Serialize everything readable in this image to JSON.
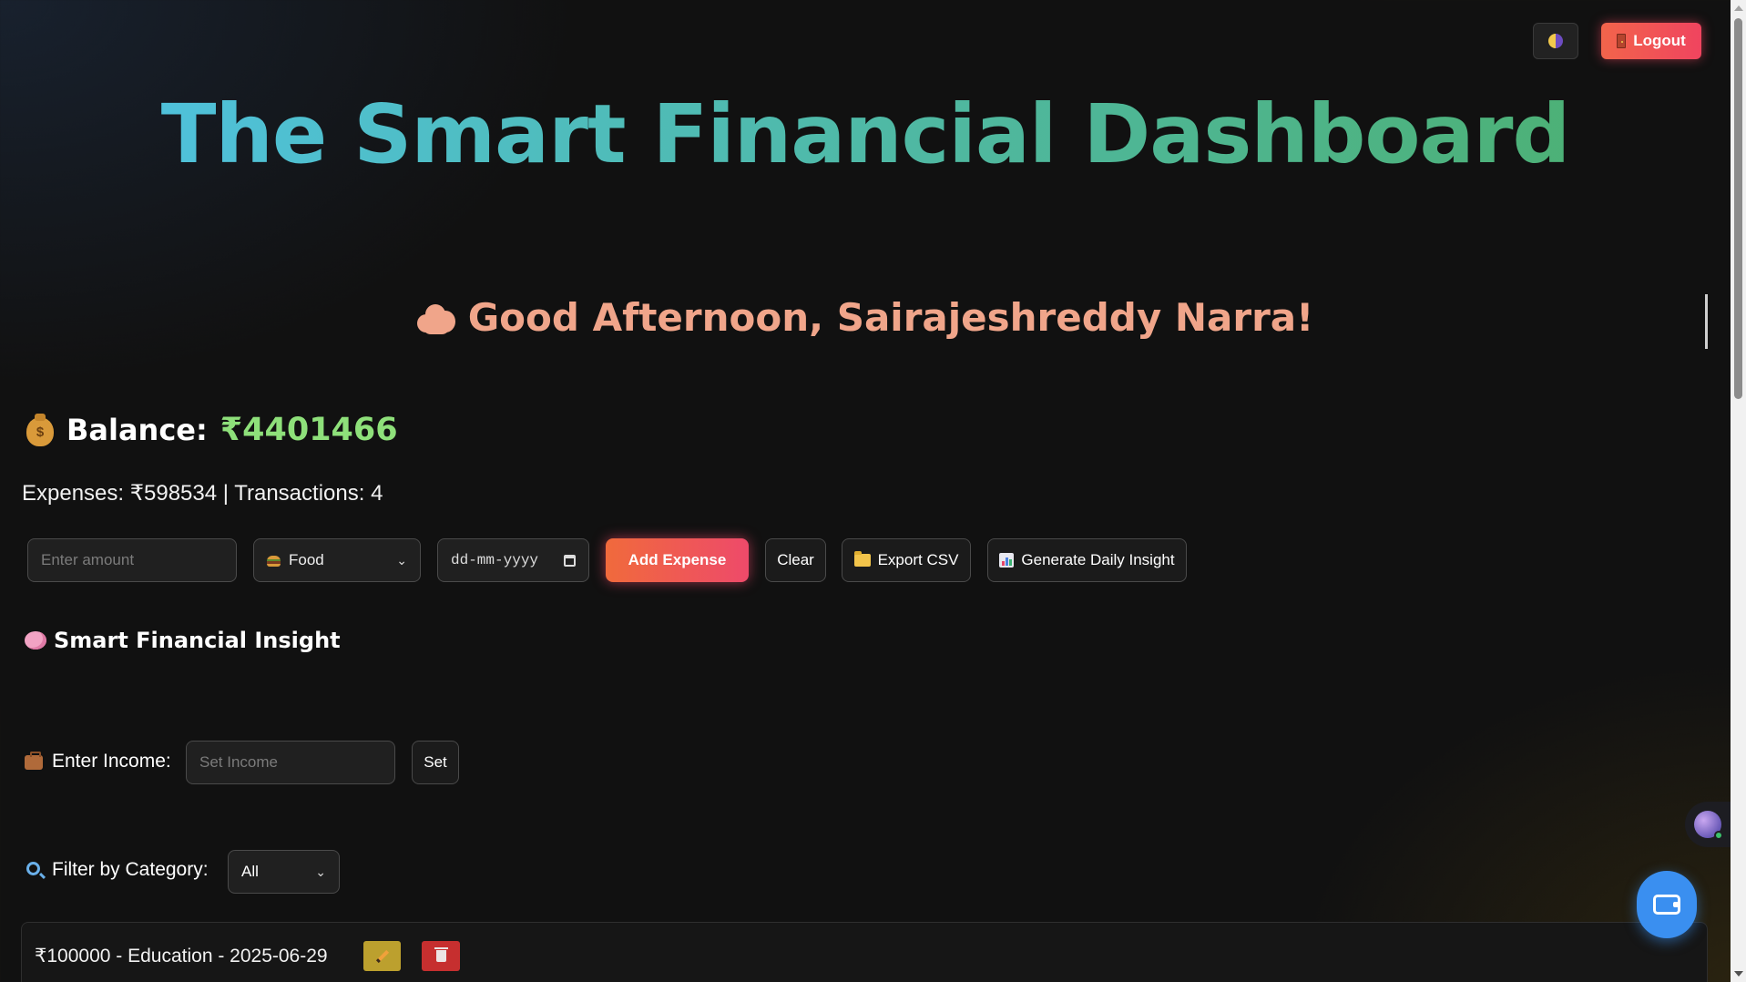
{
  "header": {
    "theme_toggle_icon": "half-moon-icon",
    "logout_label": "Logout",
    "logout_icon": "door-icon"
  },
  "title": "The Smart Financial Dashboard",
  "greeting": {
    "icon": "cloud-icon",
    "text": "Good Afternoon, Sairajeshreddy Narra!"
  },
  "balance": {
    "icon": "moneybag-icon",
    "label": "Balance:",
    "value": "₹4401466"
  },
  "stats_text": "Expenses: ₹598534 | Transactions: 4",
  "expense_form": {
    "amount_placeholder": "Enter amount",
    "category_selected": "Food",
    "category_icon": "burger-icon",
    "date_placeholder": "dd-mm-yyyy",
    "add_label": "Add Expense",
    "clear_label": "Clear",
    "export_label": "Export CSV",
    "export_icon": "folder-icon",
    "insight_label": "Generate Daily Insight",
    "insight_icon": "bar-chart-icon"
  },
  "insight_section": {
    "icon": "brain-icon",
    "heading": "Smart Financial Insight"
  },
  "income": {
    "icon": "briefcase-icon",
    "label": "Enter Income:",
    "placeholder": "Set Income",
    "set_label": "Set"
  },
  "filter": {
    "icon": "magnifier-icon",
    "label": "Filter by Category:",
    "selected": "All"
  },
  "expenses": [
    {
      "text": "₹100000 - Education - 2025-06-29"
    }
  ],
  "colors": {
    "background": "#111111",
    "accent_orange": "#f06a3c",
    "accent_pink": "#ee4a6a",
    "balance_green": "#8ee07a",
    "greeting_peach": "#f0a58a",
    "title_start": "#4fc3e6",
    "title_end": "#4caf6c",
    "fab_blue": "#3a8ff0"
  }
}
